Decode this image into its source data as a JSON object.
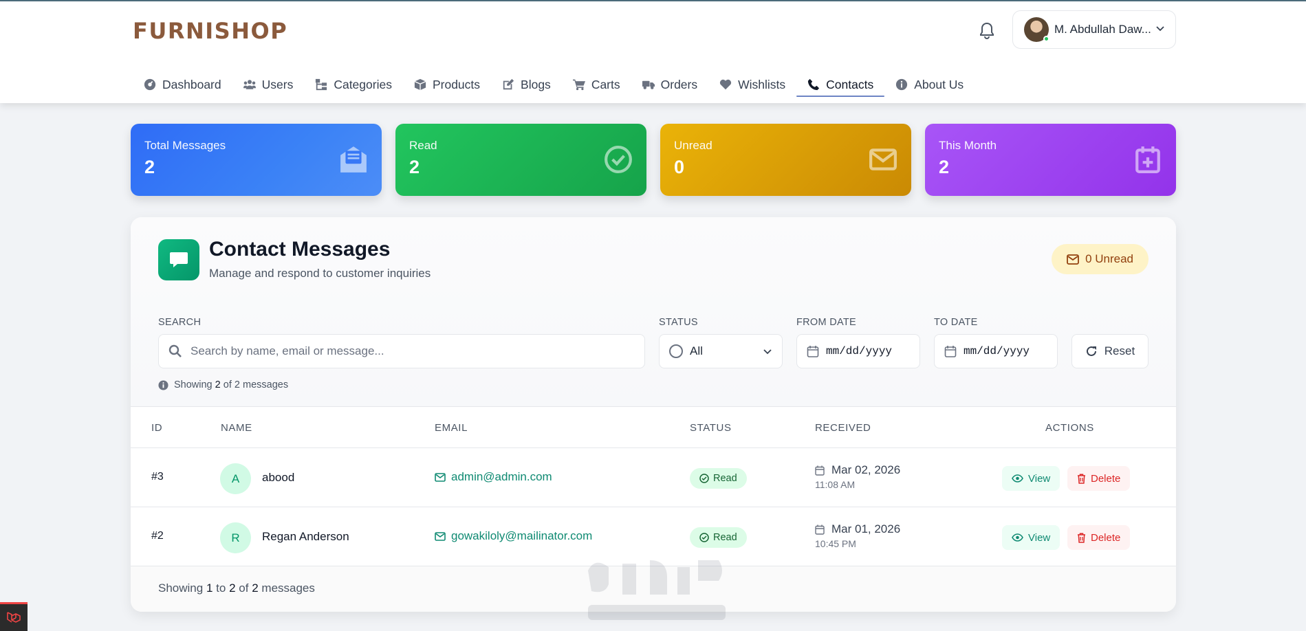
{
  "brand": {
    "logo": "FURNISHOP"
  },
  "user": {
    "name": "M. Abdullah Daw..."
  },
  "nav": {
    "items": [
      {
        "label": "Dashboard",
        "icon": "dashboard-icon"
      },
      {
        "label": "Users",
        "icon": "users-icon"
      },
      {
        "label": "Categories",
        "icon": "categories-icon"
      },
      {
        "label": "Products",
        "icon": "box-icon"
      },
      {
        "label": "Blogs",
        "icon": "edit-icon"
      },
      {
        "label": "Carts",
        "icon": "cart-icon"
      },
      {
        "label": "Orders",
        "icon": "truck-icon"
      },
      {
        "label": "Wishlists",
        "icon": "heart-icon"
      },
      {
        "label": "Contacts",
        "icon": "phone-icon",
        "active": true
      },
      {
        "label": "About Us",
        "icon": "info-icon"
      }
    ]
  },
  "stats": {
    "total": {
      "label": "Total Messages",
      "value": "2",
      "color": "#3b82f6"
    },
    "read": {
      "label": "Read",
      "value": "2",
      "color": "#22c55e"
    },
    "unread": {
      "label": "Unread",
      "value": "0",
      "color": "#eab308"
    },
    "month": {
      "label": "This Month",
      "value": "2",
      "color": "#a855f7"
    }
  },
  "panel": {
    "title": "Contact Messages",
    "subtitle": "Manage and respond to customer inquiries",
    "unread_badge": "0 Unread"
  },
  "filters": {
    "search_label": "SEARCH",
    "search_placeholder": "Search by name, email or message...",
    "status_label": "STATUS",
    "status_value": "All",
    "from_label": "FROM DATE",
    "from_value": "mm/dd/yyyy",
    "to_label": "TO DATE",
    "to_value": "mm/dd/yyyy",
    "reset_label": "Reset"
  },
  "showing_top": {
    "prefix": "Showing",
    "count": "2",
    "mid": "of",
    "total": "2",
    "suffix": "messages"
  },
  "table": {
    "headers": {
      "id": "ID",
      "name": "NAME",
      "email": "EMAIL",
      "status": "STATUS",
      "received": "RECEIVED",
      "actions": "ACTIONS"
    },
    "rows": [
      {
        "id": "#3",
        "initial": "A",
        "name": "abood",
        "email": "admin@admin.com",
        "status": "Read",
        "date": "Mar 02, 2026",
        "time": "11:08 AM",
        "view": "View",
        "delete": "Delete"
      },
      {
        "id": "#2",
        "initial": "R",
        "name": "Regan Anderson",
        "email": "gowakiloly@mailinator.com",
        "status": "Read",
        "date": "Mar 01, 2026",
        "time": "10:45 PM",
        "view": "View",
        "delete": "Delete"
      }
    ]
  },
  "footer": {
    "prefix": "Showing",
    "from": "1",
    "to_word": "to",
    "to": "2",
    "of_word": "of",
    "total": "2",
    "suffix": "messages"
  }
}
